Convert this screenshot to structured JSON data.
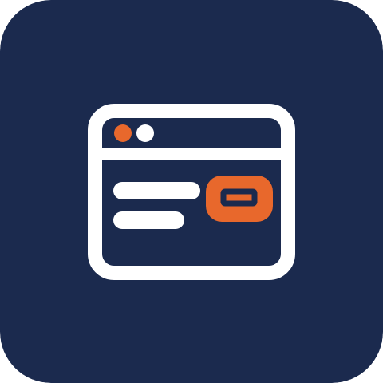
{
  "icon": {
    "name": "browser-window-app-icon",
    "colors": {
      "background": "#1B2A4E",
      "foreground": "#FFFFFF",
      "accent": "#E8682C"
    }
  }
}
